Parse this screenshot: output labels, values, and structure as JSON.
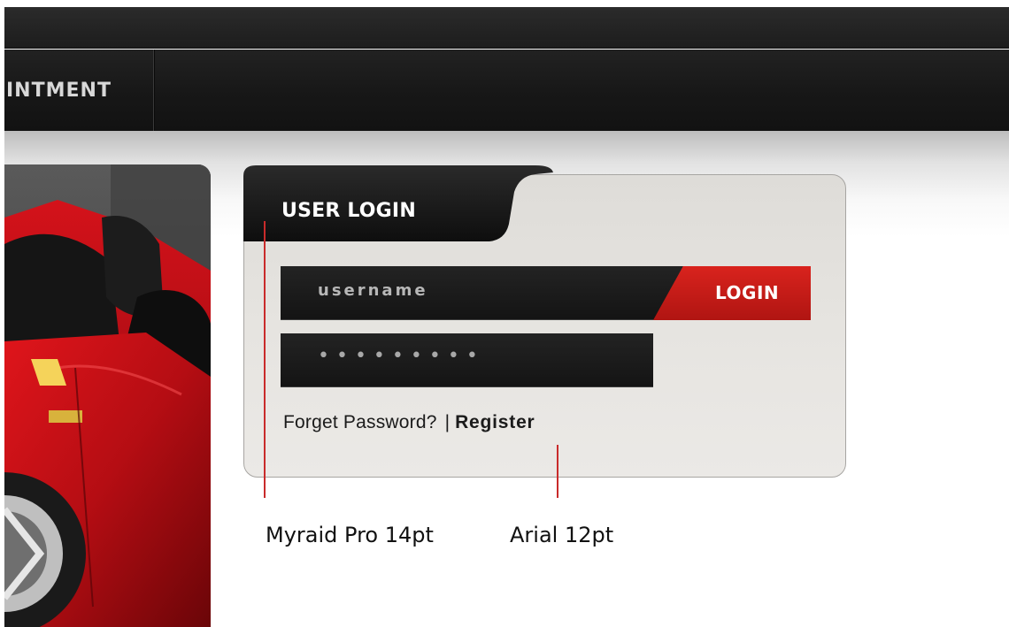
{
  "nav": {
    "items": [
      {
        "label": "INTMENT"
      }
    ]
  },
  "login": {
    "title": "USER LOGIN",
    "username_placeholder": "username",
    "password_mask": "•••••••••",
    "button_label": "LOGIN",
    "forgot_label": "Forget Password?",
    "separator": "|",
    "register_label": "Register"
  },
  "annotations": {
    "title_font": "Myraid Pro 14pt",
    "link_font": "Arial 12pt",
    "pointer_color": "#c92b2b"
  },
  "colors": {
    "accent_red": "#d9231d",
    "dark_bar": "#1d1d1d",
    "panel_bg": "#e6e4e0"
  }
}
